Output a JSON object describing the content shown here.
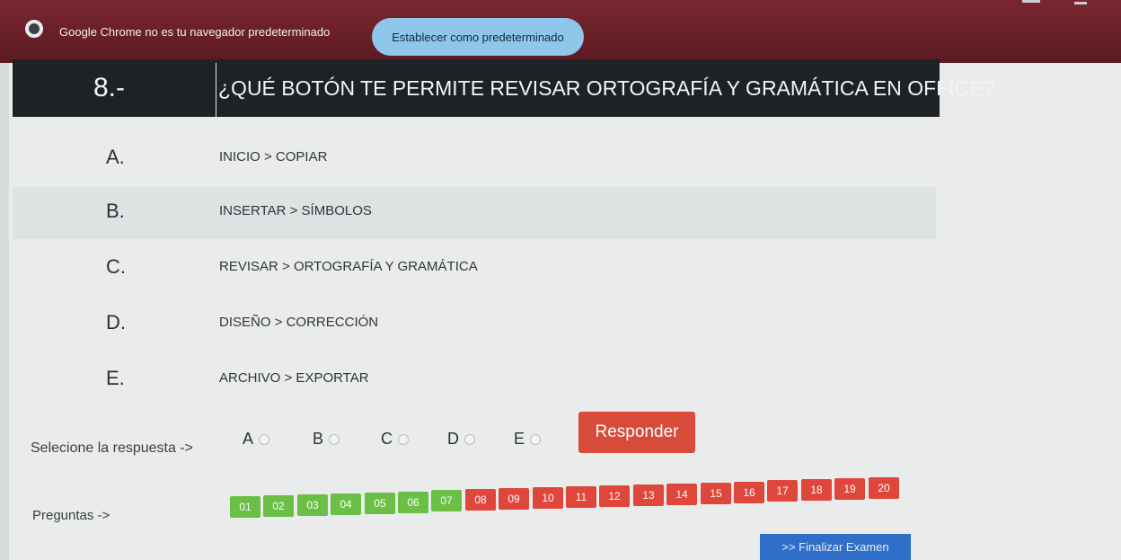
{
  "browser_bar": {
    "message": "Google Chrome no es tu navegador predeterminado",
    "set_default_label": "Establecer como predeterminado"
  },
  "question": {
    "number": "8.-",
    "text": "¿QUÉ BOTÓN TE PERMITE REVISAR ORTOGRAFÍA Y GRAMÁTICA EN OFFICE?"
  },
  "options": [
    {
      "letter": "A.",
      "text": "INICIO > COPIAR"
    },
    {
      "letter": "B.",
      "text": "INSERTAR > SÍMBOLOS"
    },
    {
      "letter": "C.",
      "text": "REVISAR > ORTOGRAFÍA Y GRAMÁTICA"
    },
    {
      "letter": "D.",
      "text": "DISEÑO > CORRECCIÓN"
    },
    {
      "letter": "E.",
      "text": "ARCHIVO > EXPORTAR"
    }
  ],
  "answer": {
    "label": "Selecione la respuesta ->",
    "choices": [
      "A",
      "B",
      "C",
      "D",
      "E"
    ],
    "respond_label": "Responder"
  },
  "questions_nav": {
    "label": "Preguntas ->",
    "items": [
      "01",
      "02",
      "03",
      "04",
      "05",
      "06",
      "07",
      "08",
      "09",
      "10",
      "11",
      "12",
      "13",
      "14",
      "15",
      "16",
      "17",
      "18",
      "19",
      "20"
    ],
    "answered_color": "#6bbf47",
    "pending_color": "#e0473c"
  },
  "finish_label": ">> Finalizar Examen",
  "icons": {
    "browser": "chrome-icon",
    "cursor": "hand-cursor-icon"
  }
}
